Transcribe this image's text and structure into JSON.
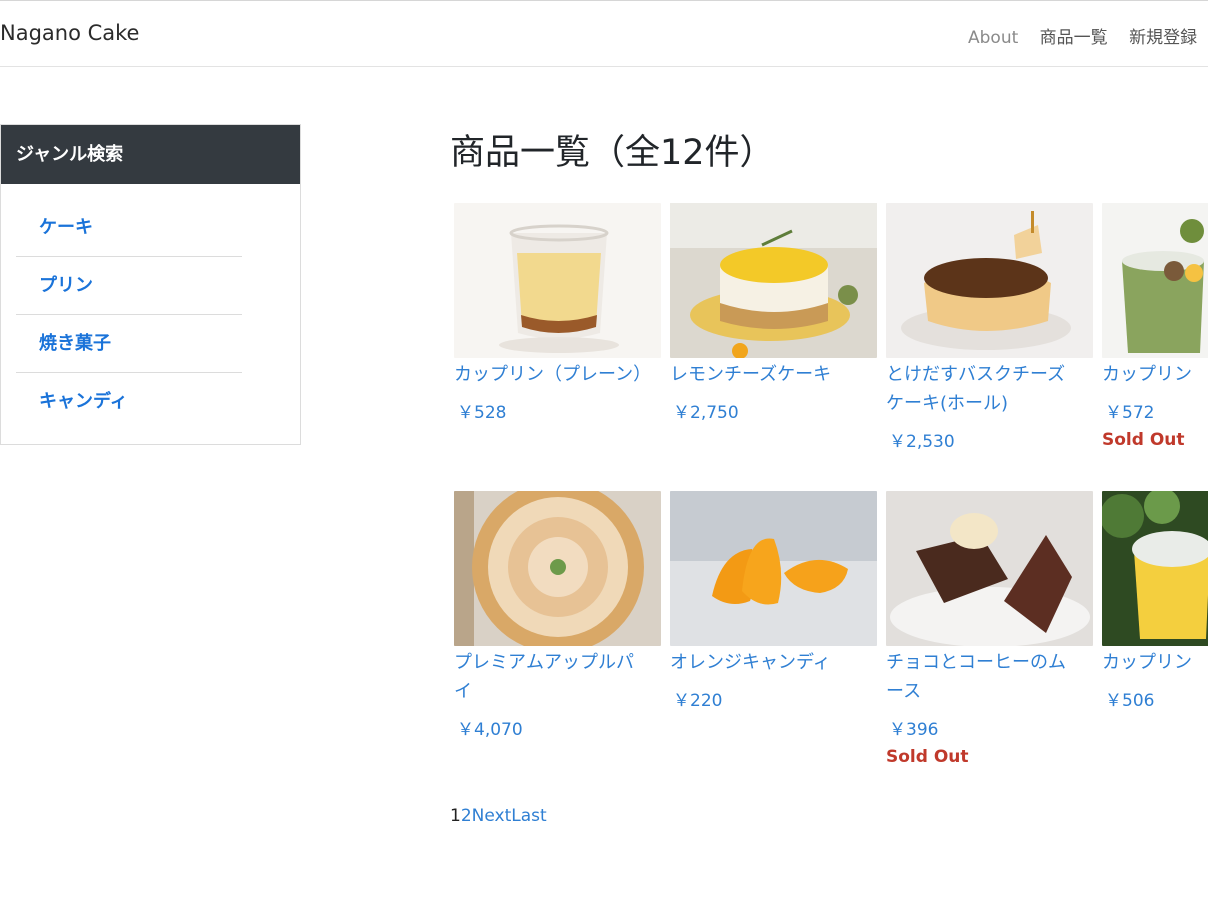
{
  "navbar": {
    "brand": "Nagano Cake",
    "links": [
      "About",
      "商品一覧",
      "新規登録"
    ]
  },
  "sidebar": {
    "header": "ジャンル検索",
    "genres": [
      "ケーキ",
      "プリン",
      "焼き菓子",
      "キャンディ"
    ]
  },
  "main": {
    "title": "商品一覧（全12件）"
  },
  "products": [
    {
      "name": "カップリン（プレーン）",
      "price": "￥528",
      "sold_out": ""
    },
    {
      "name": "レモンチーズケーキ",
      "price": "￥2,750",
      "sold_out": ""
    },
    {
      "name": "とけだすバスクチーズケーキ(ホール)",
      "price": "￥2,530",
      "sold_out": ""
    },
    {
      "name": "カップリン",
      "price": "￥572",
      "sold_out": "Sold Out"
    },
    {
      "name": "プレミアムアップルパイ",
      "price": "￥4,070",
      "sold_out": ""
    },
    {
      "name": "オレンジキャンディ",
      "price": "￥220",
      "sold_out": ""
    },
    {
      "name": "チョコとコーヒーのムース",
      "price": "￥396",
      "sold_out": "Sold Out"
    },
    {
      "name": "カップリン",
      "price": "￥506",
      "sold_out": ""
    }
  ],
  "pagination": {
    "current": "1",
    "page2": "2",
    "next": "Next",
    "last": "Last"
  },
  "colors": {
    "link": "#2f7fd3",
    "sold_out": "#c0392b",
    "sidebar_header": "#343a40"
  }
}
